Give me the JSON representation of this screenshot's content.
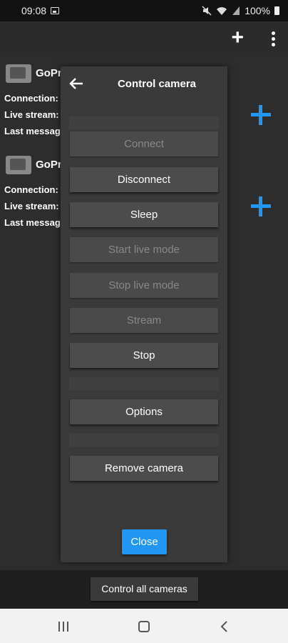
{
  "status_bar": {
    "time": "09:08",
    "battery": "100%"
  },
  "cameras": [
    {
      "name": "GoPr",
      "connection_label": "Connection:",
      "live_label": "Live stream:",
      "last_label": "Last messag"
    },
    {
      "name": "GoPr",
      "connection_label": "Connection:",
      "live_label": "Live stream:",
      "last_label": "Last messag"
    }
  ],
  "dialog": {
    "title": "Control camera",
    "buttons": [
      {
        "label": "Connect",
        "enabled": false
      },
      {
        "label": "Disconnect",
        "enabled": true
      },
      {
        "label": "Sleep",
        "enabled": true
      },
      {
        "label": "Start live mode",
        "enabled": false
      },
      {
        "label": "Stop live mode",
        "enabled": false
      },
      {
        "label": "Stream",
        "enabled": false
      },
      {
        "label": "Stop",
        "enabled": true
      },
      {
        "label": "Options",
        "enabled": true
      },
      {
        "label": "Remove camera",
        "enabled": true
      }
    ],
    "close_label": "Close"
  },
  "bottom": {
    "control_all_label": "Control all cameras"
  },
  "colors": {
    "accent": "#2196f3",
    "background": "#2d2d2d",
    "dialog": "#3a3a3a"
  },
  "icons": [
    "image-icon",
    "mute-icon",
    "wifi-icon",
    "signal-icon",
    "battery-icon",
    "add-icon",
    "more-vert-icon",
    "back-arrow-icon",
    "camera-thumbnail",
    "recents-icon",
    "home-icon",
    "nav-back-icon"
  ]
}
